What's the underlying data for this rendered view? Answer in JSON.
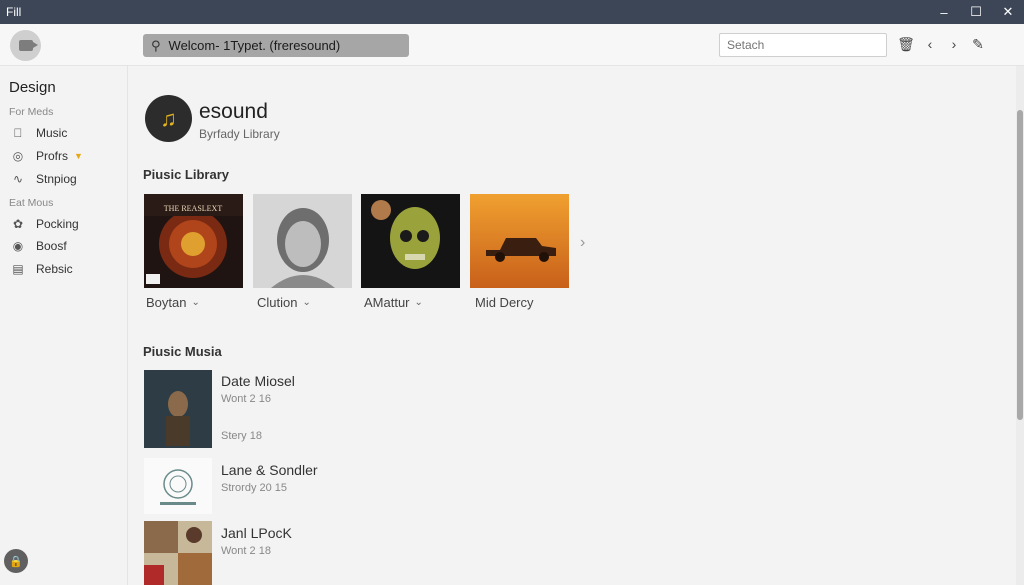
{
  "window": {
    "title": "Fill",
    "controls": [
      "minimize",
      "maximize",
      "close"
    ]
  },
  "toolbar": {
    "search_text": "Welcom- 1Typet. (freresound)",
    "search_placeholder": "Setach",
    "icons": [
      "trash-icon",
      "back-icon",
      "forward-icon",
      "edit-icon"
    ]
  },
  "sidebar": {
    "title": "Design",
    "sections": [
      {
        "label": "For Meds",
        "items": [
          {
            "label": "Music",
            "icon": "apple-icon"
          },
          {
            "label": "Profrs",
            "icon": "target-icon",
            "badge": "▼"
          },
          {
            "label": "Stnpiog",
            "icon": "wave-icon"
          }
        ]
      },
      {
        "label": "Eat Mous",
        "items": [
          {
            "label": "Pocking",
            "icon": "leaf-icon"
          },
          {
            "label": "Boosf",
            "icon": "bolt-icon"
          },
          {
            "label": "Rebsic",
            "icon": "list-icon"
          }
        ]
      }
    ]
  },
  "artist": {
    "name": "esound",
    "subtitle": "Byrfady Library"
  },
  "library": {
    "heading": "Piusic Library",
    "tiles": [
      {
        "label": "Boytan",
        "art_text": "THE REASLEXT"
      },
      {
        "label": "Clution"
      },
      {
        "label": "AMattur"
      },
      {
        "label": "Mid Dercy"
      }
    ]
  },
  "music": {
    "heading": "Piusic Musia",
    "items": [
      {
        "title": "Date Miosel",
        "sub1": "Wont 2 16",
        "sub2": "Stery 18"
      },
      {
        "title": "Lane & Sondler",
        "sub1": "Strordy 20 15"
      },
      {
        "title": "Janl LPocK",
        "sub1": "Wont 2 18"
      }
    ]
  },
  "colors": {
    "titlebar": "#3c4657",
    "accent": "#e6a817"
  }
}
